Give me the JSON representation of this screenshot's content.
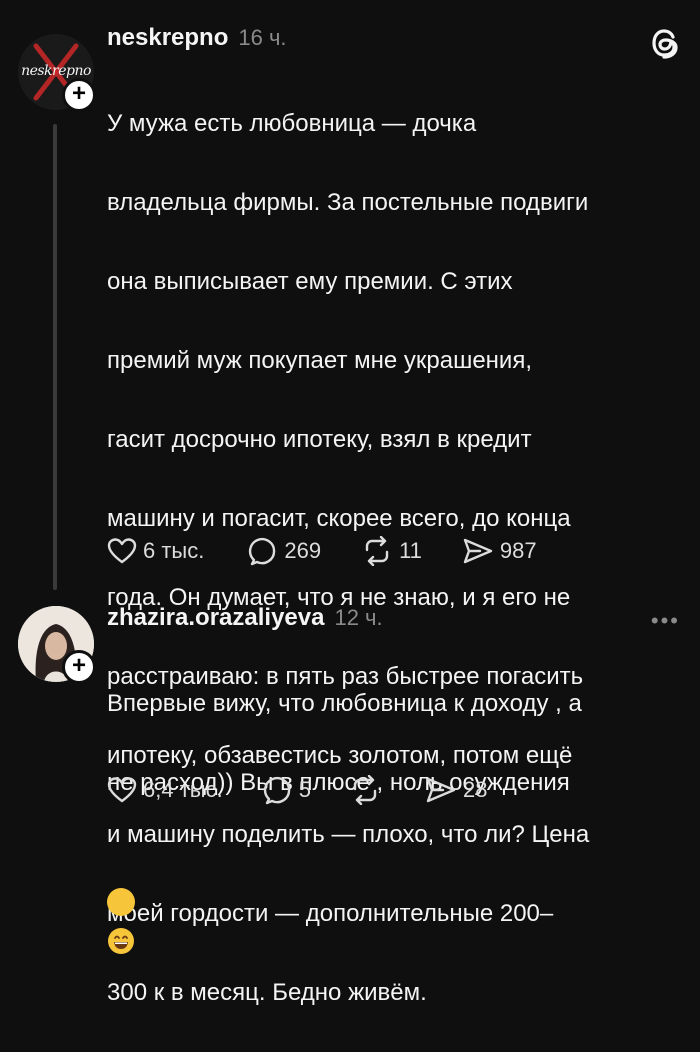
{
  "post1": {
    "avatar_text": "neskrepno",
    "username": "neskrepno",
    "time": "16 ч.",
    "lines": [
      "У мужа есть любовница — дочка",
      "владельца фирмы. За постельные подвиги",
      "она выписывает ему премии. С этих",
      "премий муж покупает мне украшения,",
      "гасит досрочно ипотеку, взял в кредит",
      "машину и погасит, скорее всего, до конца",
      "года. Он думает, что я не знаю, и я его не",
      "расстраиваю: в пять раз быстрее погасить",
      "ипотеку, обзавестись золотом, потом ещё",
      "и машину поделить — плохо, что ли? Цена",
      "моей гордости — дополнительные 200–",
      "300 к в месяц. Бедно живём."
    ],
    "likes": "6 тыс.",
    "comments": "269",
    "reposts": "11",
    "shares": "987"
  },
  "post2": {
    "username": "zhazira.orazaliyeva",
    "time": "12 ч.",
    "more": "•••",
    "lines": [
      "Впервые вижу, что любовница к доходу , а",
      "не расход)) Вы в плюсе , ноль осуждения"
    ],
    "likes": "6,4 тыс.",
    "comments": "5",
    "shares": "28"
  },
  "icons": {
    "like": "heart-icon",
    "comment": "comment-bubble-icon",
    "repost": "repost-icon",
    "share": "share-send-icon",
    "threads": "threads-logo-icon",
    "follow": "plus-icon"
  },
  "colors": {
    "background": "#0f0f0f",
    "text": "#f4f4f4",
    "muted": "#8a8a8a"
  }
}
